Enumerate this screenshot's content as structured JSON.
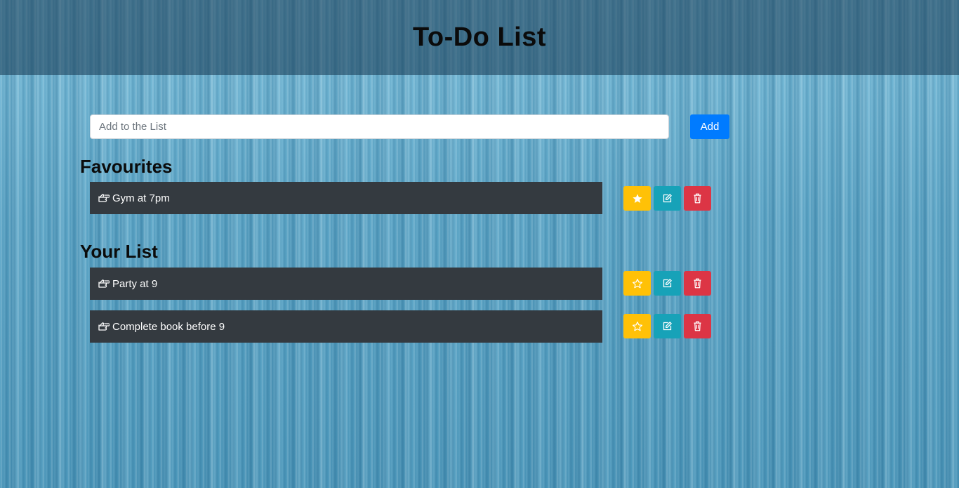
{
  "header": {
    "title": "To-Do List"
  },
  "add_form": {
    "placeholder": "Add to the List",
    "value": "",
    "button_label": "Add"
  },
  "sections": {
    "favourites": {
      "title": "Favourites",
      "items": [
        {
          "text": "Gym at 7pm",
          "starred": true
        }
      ]
    },
    "your_list": {
      "title": "Your List",
      "items": [
        {
          "text": "Party at 9",
          "starred": false
        },
        {
          "text": "Complete book before 9",
          "starred": false
        }
      ]
    }
  },
  "icons": {
    "item_icon": "hand-pointing-right-icon",
    "star_filled": "star-filled-icon",
    "star_outline": "star-outline-icon",
    "edit": "edit-icon",
    "delete": "trash-icon"
  },
  "colors": {
    "header_overlay": "#1a3a52",
    "add_button": "#007bff",
    "item_bar": "#343a40",
    "star_button": "#ffc107",
    "edit_button": "#17a2b8",
    "delete_button": "#dc3545"
  }
}
